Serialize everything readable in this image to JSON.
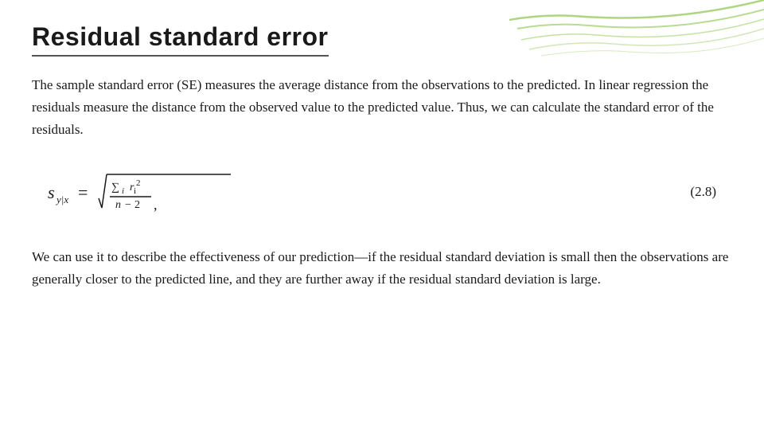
{
  "page": {
    "title": "Residual standard error",
    "paragraph1": "The sample standard error (SE) measures the average distance from the observations to the predicted. In linear regression the residuals measure the distance from the observed value to the predicted value. Thus, we can calculate the standard error of the residuals.",
    "formula_number": "(2.8)",
    "paragraph2": "We can use it to describe the effectiveness of our prediction—if the residual standard deviation is small then the observations are generally closer to the predicted line, and they are further away if the residual standard deviation is large."
  }
}
